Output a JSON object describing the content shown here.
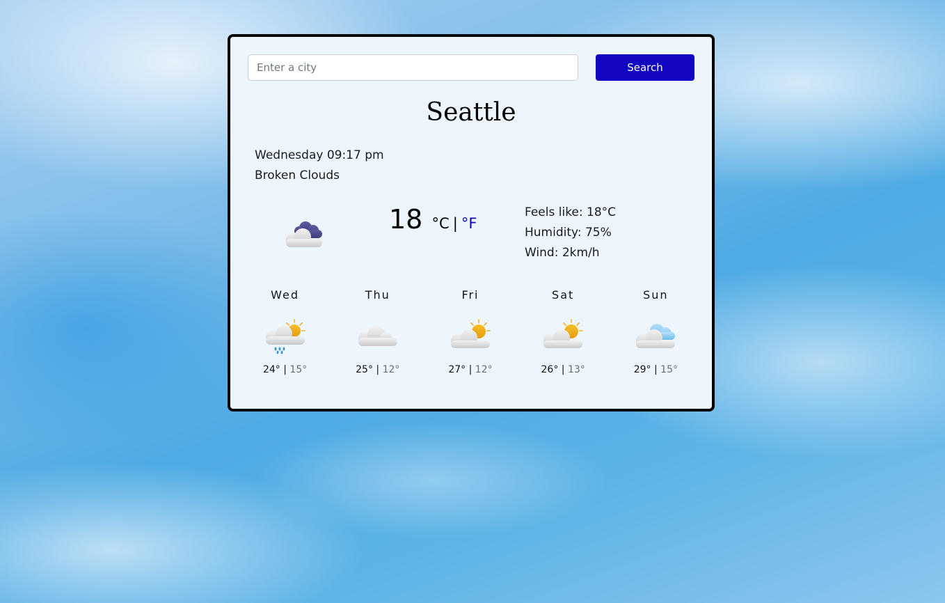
{
  "search": {
    "placeholder": "Enter a city",
    "value": "",
    "button_label": "Search"
  },
  "weather": {
    "city": "Seattle",
    "datetime": "Wednesday 09:17 pm",
    "condition": "Broken Clouds",
    "icon": "broken-clouds-night-icon",
    "temperature": "18",
    "unit_c": "°C",
    "unit_separator": "|",
    "unit_f": "°F",
    "feels_like": "Feels like: 18°C",
    "humidity": "Humidity: 75%",
    "wind": "Wind: 2km/h"
  },
  "forecast": [
    {
      "day": "Wed",
      "icon": "rain-sun-cloud-icon",
      "max": "24°",
      "min": "15°"
    },
    {
      "day": "Thu",
      "icon": "cloud-icon",
      "max": "25°",
      "min": "12°"
    },
    {
      "day": "Fri",
      "icon": "partly-sunny-icon",
      "max": "27°",
      "min": "12°"
    },
    {
      "day": "Sat",
      "icon": "partly-sunny-icon",
      "max": "26°",
      "min": "13°"
    },
    {
      "day": "Sun",
      "icon": "few-clouds-icon",
      "max": "29°",
      "min": "15°"
    }
  ],
  "colors": {
    "accent": "#1205c1",
    "card_bg": "#eef6fd",
    "min_temp": "#6b6b6b"
  }
}
